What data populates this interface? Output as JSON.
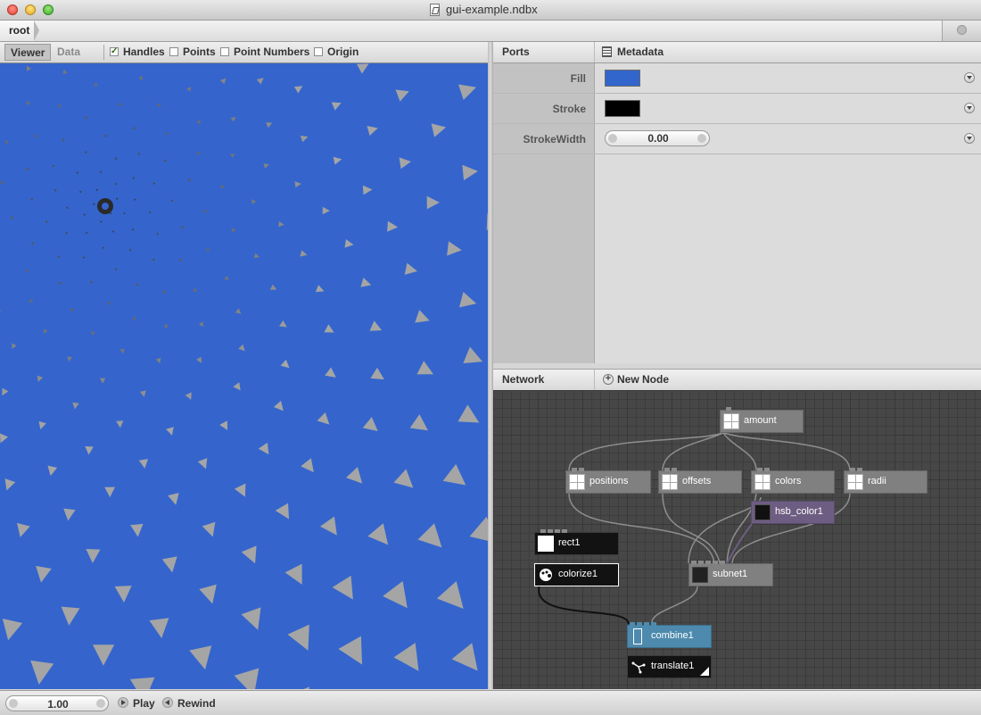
{
  "window": {
    "title": "gui-example.ndbx"
  },
  "breadcrumb": {
    "root": "root"
  },
  "viewer_toolbar": {
    "tabs": [
      {
        "label": "Viewer",
        "selected": true
      },
      {
        "label": "Data",
        "selected": false
      }
    ],
    "toggles": [
      {
        "label": "Handles",
        "checked": true
      },
      {
        "label": "Points",
        "checked": false
      },
      {
        "label": "Point Numbers",
        "checked": false
      },
      {
        "label": "Origin",
        "checked": false
      }
    ]
  },
  "viewer": {
    "background_color": "#3565cc",
    "shape_color": "#a3a3a3",
    "center_color": "#2b2b2b"
  },
  "ports": {
    "title": "Ports",
    "metadata_label": "Metadata",
    "rows": [
      {
        "label": "Fill",
        "type": "color",
        "value": "#3366cc"
      },
      {
        "label": "Stroke",
        "type": "color",
        "value": "#000000"
      },
      {
        "label": "StrokeWidth",
        "type": "number",
        "value": "0.00"
      }
    ]
  },
  "network": {
    "title": "Network",
    "new_node_label": "New Node",
    "nodes": [
      {
        "id": "amount",
        "label": "amount",
        "style": "gray",
        "icon": "grid-icon"
      },
      {
        "id": "positions",
        "label": "positions",
        "style": "gray",
        "icon": "grid-icon"
      },
      {
        "id": "offsets",
        "label": "offsets",
        "style": "gray",
        "icon": "grid-icon"
      },
      {
        "id": "colors",
        "label": "colors",
        "style": "gray",
        "icon": "grid-icon"
      },
      {
        "id": "radii",
        "label": "radii",
        "style": "gray",
        "icon": "grid-icon"
      },
      {
        "id": "hsb_color1",
        "label": "hsb_color1",
        "style": "purple",
        "icon": "color-icon"
      },
      {
        "id": "rect1",
        "label": "rect1",
        "style": "dark",
        "icon": "rect-icon"
      },
      {
        "id": "colorize1",
        "label": "colorize1",
        "style": "dark-selected",
        "icon": "palette-icon"
      },
      {
        "id": "subnet1",
        "label": "subnet1",
        "style": "gray",
        "icon": "subnet-icon"
      },
      {
        "id": "combine1",
        "label": "combine1",
        "style": "blue",
        "icon": "list-icon"
      },
      {
        "id": "translate1",
        "label": "translate1",
        "style": "dark-rendered",
        "icon": "translate-icon"
      }
    ]
  },
  "playback": {
    "frame": "1.00",
    "play_label": "Play",
    "rewind_label": "Rewind"
  }
}
